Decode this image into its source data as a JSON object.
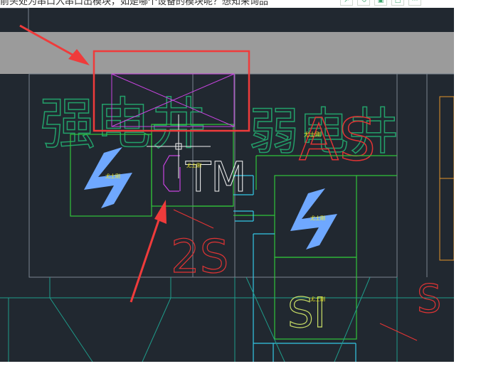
{
  "question": {
    "text": "前头处为串口入串口出模块，如是哪个设备的模块呢？想知来询品"
  },
  "toolbar": {
    "icons": [
      "share-icon",
      "link-icon",
      "image-icon",
      "copy-icon",
      "more-icon"
    ]
  },
  "drawing": {
    "label_strong_shaft": "强电井",
    "label_weak_shaft": "弱电井",
    "label_as": "AS",
    "label_tm": "TM",
    "label_2s": "2S",
    "label_si": "SI",
    "label_s": "S",
    "small_tag_1": "尤士刚",
    "small_tag_2": "尤士刚",
    "small_tag_3": "尤士刚",
    "small_tag_4": "尤士刚",
    "small_tag_5": "尤士刚"
  },
  "colors": {
    "canvas_bg": "#212830",
    "gray_band": "#9b9b9b",
    "highlight_box": "#ef3b3b",
    "arrow": "#ef3b3b",
    "green_wall": "#31c43a",
    "teal_line": "#1f9b8a",
    "cyan_line": "#33c8e6",
    "magenta": "#c844e0",
    "blue_symbol": "#6fa8ff",
    "red_text": "#e03434",
    "yellow_tag": "#f3ee22",
    "orange_line": "#e3932a",
    "gray_line": "#7a8591",
    "white_line": "#f2f2f2"
  }
}
